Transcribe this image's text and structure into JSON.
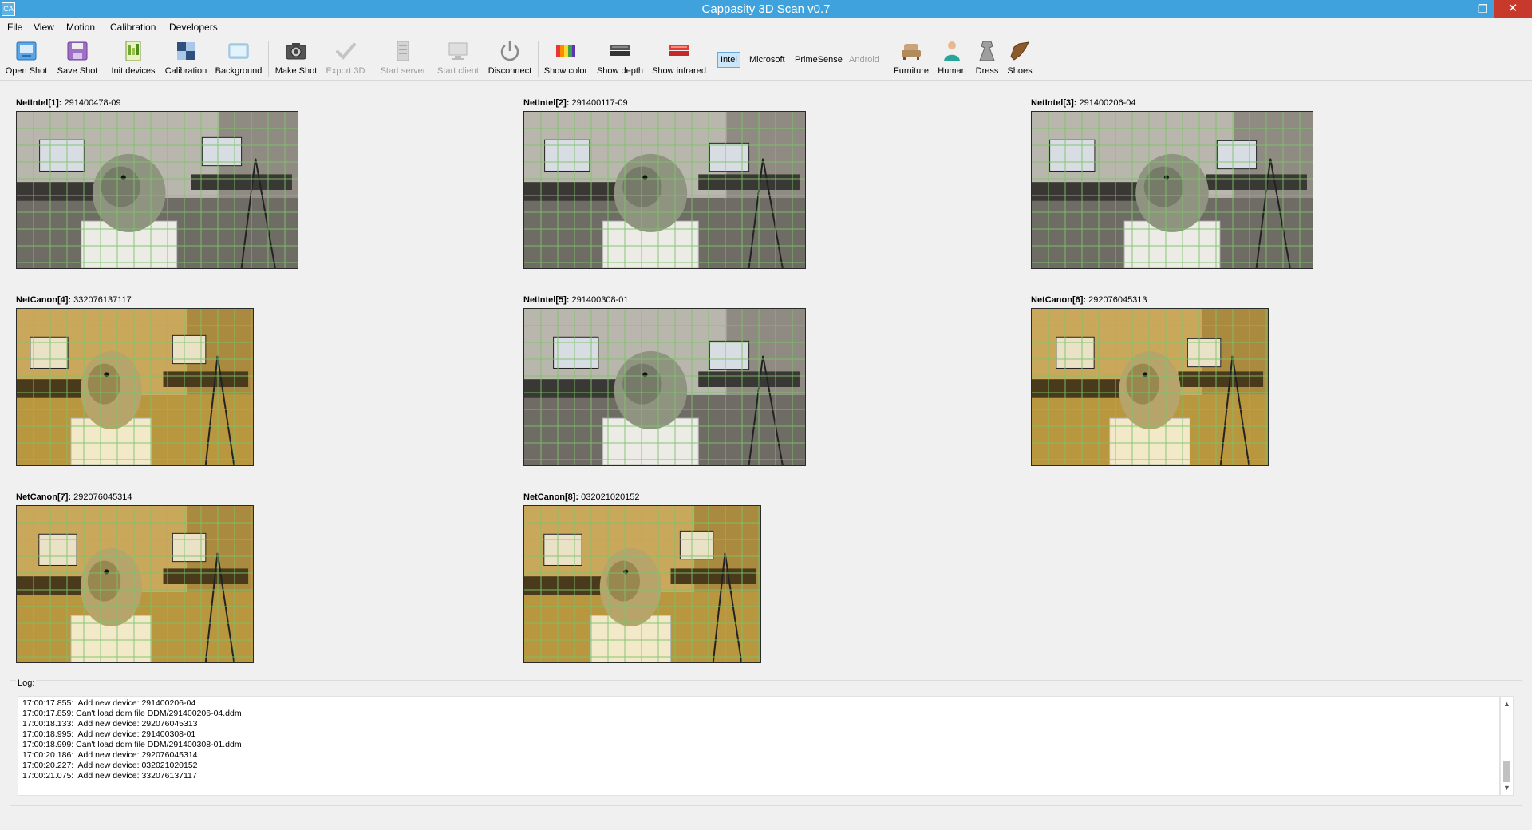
{
  "window": {
    "title": "Cappasity 3D Scan v0.7",
    "app_icon_text": "CA",
    "minimize_glyph": "–",
    "maximize_glyph": "❐",
    "close_glyph": "✕"
  },
  "menu": [
    {
      "label": "File"
    },
    {
      "label": "View"
    },
    {
      "label": "Motion"
    },
    {
      "label": "Calibration"
    },
    {
      "label": "Developers"
    }
  ],
  "toolbar": {
    "buttons": [
      {
        "label": "Open Shot",
        "icon": "open-shot-icon",
        "enabled": true
      },
      {
        "label": "Save Shot",
        "icon": "save-shot-icon",
        "enabled": true
      },
      {
        "label": "Init devices",
        "icon": "init-devices-icon",
        "enabled": true
      },
      {
        "label": "Calibration",
        "icon": "calibration-icon",
        "enabled": true
      },
      {
        "label": "Background",
        "icon": "background-icon",
        "enabled": true
      },
      {
        "label": "Make Shot",
        "icon": "camera-icon",
        "enabled": true
      },
      {
        "label": "Export 3D",
        "icon": "checkmark-icon",
        "enabled": false
      },
      {
        "label": "Start server",
        "icon": "server-icon",
        "enabled": false
      },
      {
        "label": "Start client",
        "icon": "client-icon",
        "enabled": false
      },
      {
        "label": "Disconnect",
        "icon": "power-icon",
        "enabled": true
      },
      {
        "label": "Show color",
        "icon": "color-icon",
        "enabled": true
      },
      {
        "label": "Show depth",
        "icon": "depth-icon",
        "enabled": true
      },
      {
        "label": "Show infrared",
        "icon": "infrared-icon",
        "enabled": true
      }
    ],
    "sensors": [
      {
        "label": "Intel",
        "active": true,
        "enabled": true
      },
      {
        "label": "Microsoft",
        "active": false,
        "enabled": true
      },
      {
        "label": "PrimeSense",
        "active": false,
        "enabled": true
      },
      {
        "label": "Android",
        "active": false,
        "enabled": false
      }
    ],
    "categories": [
      {
        "label": "Furniture",
        "icon": "armchair-icon"
      },
      {
        "label": "Human",
        "icon": "human-icon"
      },
      {
        "label": "Dress",
        "icon": "dress-icon"
      },
      {
        "label": "Shoes",
        "icon": "shoe-icon"
      }
    ]
  },
  "cameras": [
    {
      "name": "NetIntel[1]:",
      "serial": "291400478-09",
      "tone": "gray"
    },
    {
      "name": "NetIntel[2]:",
      "serial": "291400117-09",
      "tone": "gray"
    },
    {
      "name": "NetIntel[3]:",
      "serial": "291400206-04",
      "tone": "gray"
    },
    {
      "name": "NetCanon[4]:",
      "serial": "332076137117",
      "tone": "warm"
    },
    {
      "name": "NetIntel[5]:",
      "serial": "291400308-01",
      "tone": "gray"
    },
    {
      "name": "NetCanon[6]:",
      "serial": "292076045313",
      "tone": "warm"
    },
    {
      "name": "NetCanon[7]:",
      "serial": "292076045314",
      "tone": "warm"
    },
    {
      "name": "NetCanon[8]:",
      "serial": "032021020152",
      "tone": "warm"
    }
  ],
  "log": {
    "label": "Log:",
    "lines": [
      "17:00:17.855:  Add new device: 291400206-04",
      "17:00:17.859: Can't load ddm file DDM/291400206-04.ddm",
      "17:00:18.133:  Add new device: 292076045313",
      "17:00:18.995:  Add new device: 291400308-01",
      "17:00:18.999: Can't load ddm file DDM/291400308-01.ddm",
      "17:00:20.186:  Add new device: 292076045314",
      "17:00:20.227:  Add new device: 032021020152",
      "17:00:21.075:  Add new device: 332076137117"
    ]
  },
  "colors": {
    "titlebar": "#3fa2dc",
    "grid": "#7ec36a",
    "close": "#c7392b"
  }
}
